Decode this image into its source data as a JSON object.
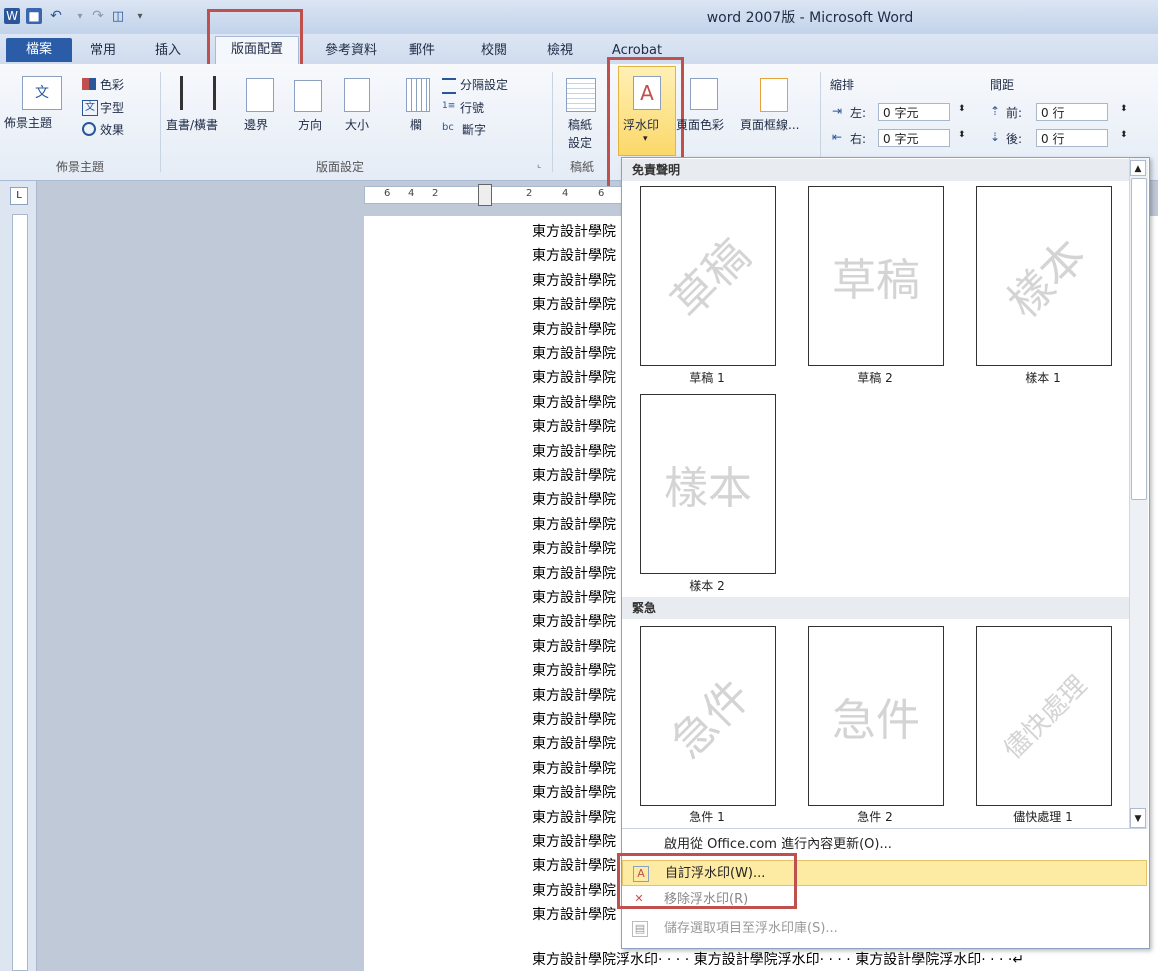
{
  "window": {
    "title": "word 2007版 - Microsoft Word"
  },
  "quick_access": {
    "icons": [
      "word-icon",
      "save-icon",
      "undo-icon",
      "redo-icon",
      "print-preview-icon",
      "customize-icon"
    ]
  },
  "tabs": [
    {
      "label": "檔案"
    },
    {
      "label": "常用"
    },
    {
      "label": "插入"
    },
    {
      "label": "版面配置"
    },
    {
      "label": "參考資料"
    },
    {
      "label": "郵件"
    },
    {
      "label": "校閱"
    },
    {
      "label": "檢視"
    },
    {
      "label": "Acrobat"
    }
  ],
  "ribbon": {
    "themes": {
      "theme_button": "佈景主題",
      "colors": "色彩",
      "fonts": "字型",
      "effects": "效果",
      "group_label": "佈景主題"
    },
    "page_setup": {
      "text_direction": "直書/橫書",
      "margins": "邊界",
      "orientation": "方向",
      "size": "大小",
      "columns": "欄",
      "breaks": "分隔設定",
      "line_numbers": "行號",
      "hyphenation": "斷字",
      "group_label": "版面設定"
    },
    "manuscript": {
      "button_top": "稿紙",
      "button_bottom": "設定",
      "group_label": "稿紙"
    },
    "page_bg": {
      "watermark": "浮水印",
      "page_color": "頁面色彩",
      "page_borders": "頁面框線..."
    },
    "paragraph": {
      "indent_label": "縮排",
      "left_label": "左:",
      "left_value": "0 字元",
      "right_label": "右:",
      "right_value": "0 字元",
      "spacing_label": "間距",
      "before_label": "前:",
      "before_value": "0 行",
      "after_label": "後:",
      "after_value": "0 行"
    }
  },
  "ruler": {
    "ticks": [
      "6",
      "4",
      "2",
      "2",
      "4",
      "6"
    ]
  },
  "document": {
    "line_text": "東方設計學院",
    "last_line": "東方設計學院浮水印· · · · 東方設計學院浮水印· · · · 東方設計學院浮水印· · · ·↵"
  },
  "gallery": {
    "section1": "免責聲明",
    "section2": "緊急",
    "items1": [
      {
        "text": "草稿",
        "caption": "草稿 1"
      },
      {
        "text": "草稿",
        "caption": "草稿 2"
      },
      {
        "text": "樣本",
        "caption": "樣本 1"
      },
      {
        "text": "樣本",
        "caption": "樣本 2"
      }
    ],
    "items2": [
      {
        "text": "急件",
        "caption": "急件 1"
      },
      {
        "text": "急件",
        "caption": "急件 2"
      },
      {
        "text": "儘快處理",
        "caption": "儘快處理 1"
      }
    ],
    "menu": [
      {
        "label": "啟用從 Office.com 進行內容更新(O)..."
      },
      {
        "label": "自訂浮水印(W)..."
      },
      {
        "label": "移除浮水印(R)"
      },
      {
        "label": "儲存選取項目至浮水印庫(S)..."
      }
    ]
  },
  "colors": {
    "highlight_box": "#c0504d",
    "menu_hover": "#fdeaa3",
    "file_tab": "#2a5ca8"
  }
}
